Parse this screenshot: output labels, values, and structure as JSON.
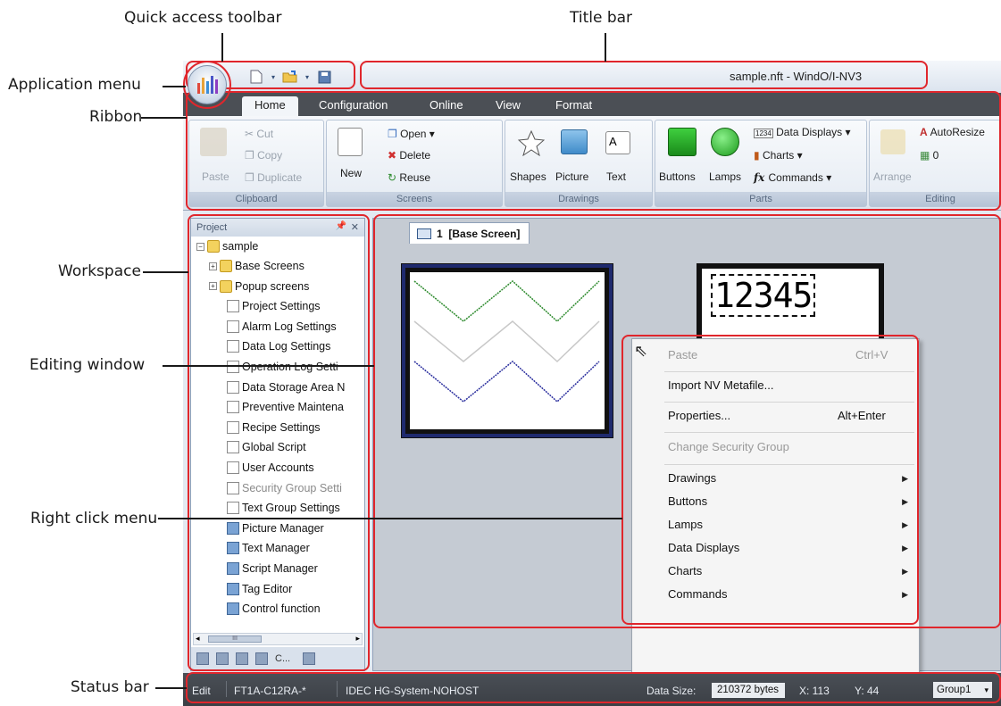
{
  "callouts": {
    "quick_access_toolbar": "Quick access toolbar",
    "title_bar": "Title bar",
    "application_menu": "Application menu",
    "ribbon": "Ribbon",
    "workspace": "Workspace",
    "editing_window": "Editing window",
    "right_click_menu": "Right click menu",
    "status_bar": "Status bar"
  },
  "window": {
    "title": "sample.nft - WindO/I-NV3"
  },
  "ribbon": {
    "tabs": [
      "Home",
      "Configuration",
      "Online",
      "View",
      "Format"
    ],
    "active_tab": "Home",
    "clipboard": {
      "label": "Clipboard",
      "paste": "Paste",
      "cut": "Cut",
      "copy": "Copy",
      "duplicate": "Duplicate"
    },
    "screens": {
      "label": "Screens",
      "new": "New",
      "open": "Open",
      "delete": "Delete",
      "reuse": "Reuse"
    },
    "drawings": {
      "label": "Drawings",
      "shapes": "Shapes",
      "picture": "Picture",
      "text": "Text",
      "text_icon": "A"
    },
    "parts": {
      "label": "Parts",
      "buttons": "Buttons",
      "lamps": "Lamps",
      "data_displays": "Data Displays",
      "charts": "Charts",
      "commands": "Commands",
      "data_icon": "1234"
    },
    "editing": {
      "label": "Editing",
      "arrange": "Arrange",
      "autoresize": "AutoResize",
      "spin_value": "0"
    }
  },
  "project": {
    "header": "Project",
    "root": "sample",
    "items": [
      {
        "label": "Base Screens",
        "type": "folder",
        "dim": false
      },
      {
        "label": "Popup screens",
        "type": "folder",
        "dim": false
      },
      {
        "label": "Project Settings",
        "type": "doc",
        "dim": false
      },
      {
        "label": "Alarm Log Settings",
        "type": "doc",
        "dim": false
      },
      {
        "label": "Data Log Settings",
        "type": "doc",
        "dim": false
      },
      {
        "label": "Operation Log Setti",
        "type": "doc",
        "dim": false
      },
      {
        "label": "Data Storage Area N",
        "type": "doc",
        "dim": false
      },
      {
        "label": "Preventive Maintena",
        "type": "doc",
        "dim": false
      },
      {
        "label": "Recipe Settings",
        "type": "doc",
        "dim": false
      },
      {
        "label": "Global Script",
        "type": "doc",
        "dim": false
      },
      {
        "label": "User Accounts",
        "type": "doc",
        "dim": false
      },
      {
        "label": "Security Group Setti",
        "type": "doc",
        "dim": true
      },
      {
        "label": "Text Group Settings",
        "type": "doc",
        "dim": false
      },
      {
        "label": "Picture Manager",
        "type": "tool",
        "dim": false
      },
      {
        "label": "Text Manager",
        "type": "tool",
        "dim": false
      },
      {
        "label": "Script Manager",
        "type": "tool",
        "dim": false
      },
      {
        "label": "Tag Editor",
        "type": "tool",
        "dim": false
      },
      {
        "label": "Control function",
        "type": "tool",
        "dim": false
      }
    ],
    "scroll_grip": "III",
    "bottom_tab_label": "C..."
  },
  "editor": {
    "tab_number": "1",
    "tab_label": "[Base Screen]",
    "data_display_digits": "12345"
  },
  "context_menu": {
    "items": [
      {
        "label": "Paste",
        "shortcut": "Ctrl+V",
        "dim": true,
        "submenu": false
      },
      {
        "label": "Import NV Metafile...",
        "shortcut": "",
        "dim": false,
        "submenu": false
      },
      {
        "label": "Properties...",
        "shortcut": "Alt+Enter",
        "dim": false,
        "submenu": false
      },
      {
        "label": "Change Security Group",
        "shortcut": "",
        "dim": true,
        "submenu": false
      },
      {
        "label": "Drawings",
        "shortcut": "",
        "dim": false,
        "submenu": true
      },
      {
        "label": "Buttons",
        "shortcut": "",
        "dim": false,
        "submenu": true
      },
      {
        "label": "Lamps",
        "shortcut": "",
        "dim": false,
        "submenu": true
      },
      {
        "label": "Data Displays",
        "shortcut": "",
        "dim": false,
        "submenu": true
      },
      {
        "label": "Charts",
        "shortcut": "",
        "dim": false,
        "submenu": true
      },
      {
        "label": "Commands",
        "shortcut": "",
        "dim": false,
        "submenu": true
      }
    ]
  },
  "statusbar": {
    "mode": "Edit",
    "model": "FT1A-C12RA-*",
    "system": "IDEC HG-System-NOHOST",
    "data_size_label": "Data Size:",
    "data_size_value": "210372 bytes",
    "x": "X: 113",
    "y": "Y: 44",
    "group": "Group1"
  },
  "colors": {
    "callout_red": "#e0262c",
    "ribbon_tab_bar": "#4b4f55",
    "statusbar": "#3b3f45",
    "chart_green": "#2e8b2e",
    "chart_gray": "#c8c8c8",
    "chart_blue": "#2b2f9e"
  }
}
